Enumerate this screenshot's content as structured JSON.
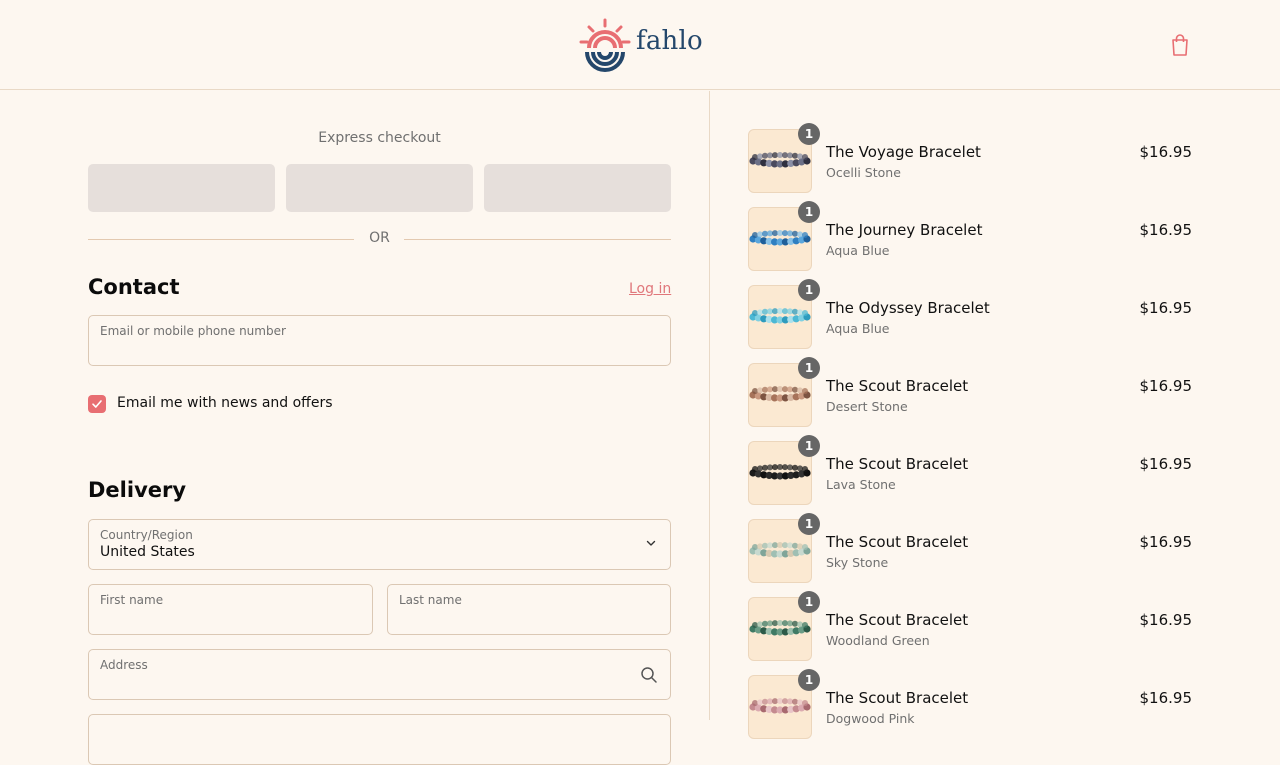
{
  "header": {
    "logo_text": "fahlo",
    "cart_icon": "shopping-bag-icon"
  },
  "express": {
    "title": "Express checkout",
    "or_text": "OR"
  },
  "contact": {
    "title": "Contact",
    "login_label": "Log in",
    "email_label": "Email or mobile phone number",
    "email_value": "",
    "newsletter_label": "Email me with news and offers",
    "newsletter_checked": true
  },
  "delivery": {
    "title": "Delivery",
    "country_label": "Country/Region",
    "country_value": "United States",
    "first_name_label": "First name",
    "last_name_label": "Last name",
    "address_label": "Address"
  },
  "colors": {
    "accent": "#e86e72",
    "brand": "#24476b",
    "background": "#fdf7f0"
  },
  "items": [
    {
      "name": "The Voyage Bracelet",
      "variant": "Ocelli Stone",
      "price": "$16.95",
      "qty": "1",
      "beads": [
        "#4a4a5e",
        "#6b6f86",
        "#2f3040",
        "#8a8fa6"
      ]
    },
    {
      "name": "The Journey Bracelet",
      "variant": "Aqua Blue",
      "price": "$16.95",
      "qty": "1",
      "beads": [
        "#2f7fc1",
        "#5aa6dc",
        "#1f5f9a",
        "#88c2e8"
      ]
    },
    {
      "name": "The Odyssey Bracelet",
      "variant": "Aqua Blue",
      "price": "$16.95",
      "qty": "1",
      "beads": [
        "#4cb8d4",
        "#7fd0e2",
        "#2e9bbd",
        "#a9e0ec"
      ]
    },
    {
      "name": "The Scout Bracelet",
      "variant": "Desert Stone",
      "price": "$16.95",
      "qty": "1",
      "beads": [
        "#a7735a",
        "#c9987f",
        "#7d5442",
        "#d8b9a4"
      ]
    },
    {
      "name": "The Scout Bracelet",
      "variant": "Lava Stone",
      "price": "$16.95",
      "qty": "1",
      "beads": [
        "#1c1c1c",
        "#333",
        "#111",
        "#2a2a2a"
      ]
    },
    {
      "name": "The Scout Bracelet",
      "variant": "Sky Stone",
      "price": "$16.95",
      "qty": "1",
      "beads": [
        "#9fbfb3",
        "#c7d9cf",
        "#7fa599",
        "#d6c9b0"
      ]
    },
    {
      "name": "The Scout Bracelet",
      "variant": "Woodland Green",
      "price": "$16.95",
      "qty": "1",
      "beads": [
        "#3f7a64",
        "#6a9c86",
        "#2c5a48",
        "#9cc0ae"
      ]
    },
    {
      "name": "The Scout Bracelet",
      "variant": "Dogwood Pink",
      "price": "$16.95",
      "qty": "1",
      "beads": [
        "#c48a8f",
        "#dbaab0",
        "#a8696f",
        "#e8c4c7"
      ]
    }
  ]
}
